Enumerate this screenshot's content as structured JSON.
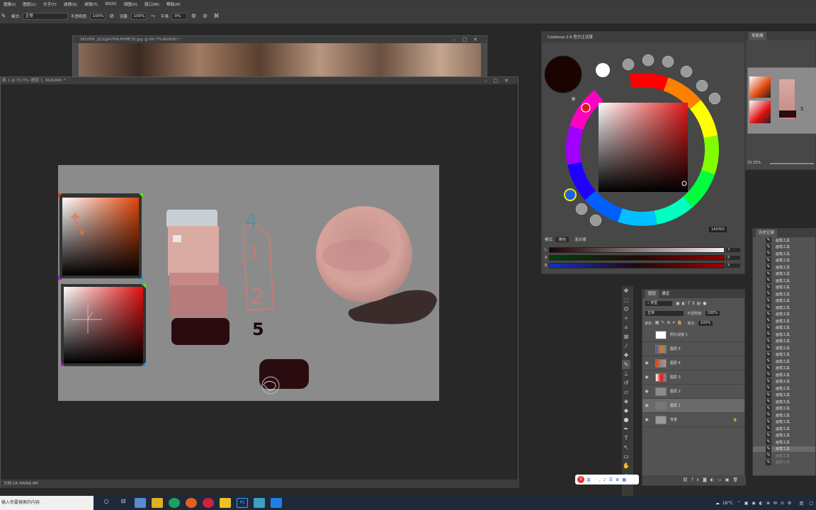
{
  "menu": [
    "图像(I)",
    "图层(L)",
    "文字(Y)",
    "选择(S)",
    "滤镜(T)",
    "3D(D)",
    "视图(V)",
    "窗口(W)",
    "帮助(H)"
  ],
  "options": {
    "mode_label": "模式:",
    "mode_value": "正常",
    "opacity_label": "不透明度:",
    "opacity_value": "100%",
    "flow_label": "流量:",
    "flow_value": "100%",
    "smooth_label": "平滑:",
    "smooth_value": "0%"
  },
  "doc_back": {
    "title": "SELVEN_(JLS@A7P9LPHNE3S.jpg @ 66.7%(RGB/8) *"
  },
  "doc_front": {
    "title": "题-1 @ 33.3% (图层 1, RGB/8#) *"
  },
  "canvas_numbers": {
    "n4": "4",
    "n1": "1",
    "n2": "2",
    "n5": "5"
  },
  "status": {
    "doc_size": "文档:18.5M/68.9M"
  },
  "coolorus": {
    "title": "Coolorus 2.6 官方正式版",
    "hex": "1A0301",
    "mode_label": "模式",
    "tabs": [
      "滑块",
      "混合器"
    ],
    "sliders": [
      {
        "label": "L",
        "value": "3"
      },
      {
        "label": "A",
        "value": "8"
      },
      {
        "label": "B",
        "value": "4"
      }
    ]
  },
  "navigator": {
    "tab": "导航器",
    "zoom": "33.33%"
  },
  "history": {
    "tab": "历史记录",
    "items": [
      "画笔工具",
      "画笔工具",
      "画笔工具",
      "画笔工具",
      "画笔工具",
      "画笔工具",
      "画笔工具",
      "画笔工具",
      "画笔工具",
      "画笔工具",
      "画笔工具",
      "画笔工具",
      "画笔工具",
      "画笔工具",
      "画笔工具",
      "画笔工具",
      "画笔工具",
      "画笔工具",
      "画笔工具",
      "画笔工具",
      "画笔工具",
      "画笔工具",
      "画笔工具",
      "画笔工具",
      "画笔工具",
      "画笔工具",
      "画笔工具",
      "画笔工具",
      "画笔工具",
      "画笔工具",
      "画笔工具",
      "画笔工具",
      "画笔工具",
      "画笔工具"
    ]
  },
  "layers": {
    "tabs": [
      "图层",
      "通道"
    ],
    "filter_label": "类型",
    "blend": "正常",
    "opacity_label": "不透明度:",
    "opacity_value": "100%",
    "lock_label": "锁定:",
    "fill_label": "填充:",
    "fill_value": "100%",
    "items": [
      {
        "name": "照片滤镜 1",
        "visible": false
      },
      {
        "name": "图层 5",
        "visible": false
      },
      {
        "name": "图层 4",
        "visible": true
      },
      {
        "name": "图层 3",
        "visible": true
      },
      {
        "name": "图层 2",
        "visible": true
      },
      {
        "name": "图层 1",
        "visible": true,
        "selected": true
      },
      {
        "name": "背景",
        "visible": true
      }
    ]
  },
  "ime": {
    "label": "英"
  },
  "taskbar": {
    "search_placeholder": "输入你要搜索的内容",
    "temp": "16°C",
    "ime": "英"
  }
}
